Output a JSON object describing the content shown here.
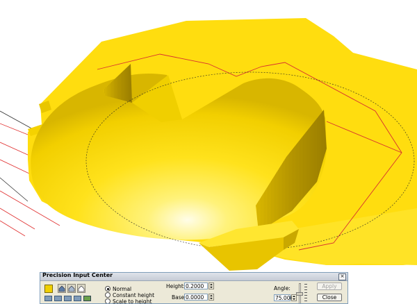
{
  "dialog": {
    "title": "Precision Input Center",
    "close_glyph": "×",
    "swatch_color": "#f0d000",
    "modes": [
      {
        "label": "Normal",
        "selected": true
      },
      {
        "label": "Constant height",
        "selected": false
      },
      {
        "label": "Scale to height",
        "selected": false
      }
    ],
    "height_label": "Height:",
    "height_value": "0.2000",
    "base_label": "Base:",
    "base_value": "0.0000",
    "angle_label": "Angle:",
    "angle_value": "75.0000",
    "apply_label": "Apply",
    "close_label": "Close",
    "icons": [
      "house-icon",
      "house-icon",
      "house-icon"
    ],
    "tool_icons": [
      "tool-icon",
      "tool-icon",
      "tool-icon",
      "tool-icon",
      "tool-icon"
    ]
  },
  "viewport": {
    "fill_color": "#ffdd0f",
    "guide_color": "#e03030"
  }
}
